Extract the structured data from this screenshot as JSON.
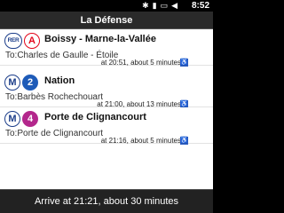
{
  "status": {
    "time": "8:52",
    "icons": [
      "bluetooth-icon",
      "signal-icon",
      "battery-icon",
      "speaker-icon"
    ]
  },
  "title": "La Défense",
  "routes": [
    {
      "mode": "RER",
      "line": "A",
      "line_color": "#e3051b",
      "name": "Boissy - Marne-la-Vallée",
      "destination": "To:Charles de Gaulle - Étoile",
      "time": "at 20:51, about 5 minutes"
    },
    {
      "mode": "M",
      "line": "2",
      "line_color": "#1e5bb8",
      "name": "Nation",
      "destination": "To:Barbès Rochechouart",
      "time": "at 21:00, about 13 minutes"
    },
    {
      "mode": "M",
      "line": "4",
      "line_color": "#b3278c",
      "name": "Porte de Clignancourt",
      "destination": "To:Porte de Clignancourt",
      "time": "at 21:16, about 5 minutes"
    }
  ],
  "footer": "Arrive at 21:21, about 30 minutes"
}
